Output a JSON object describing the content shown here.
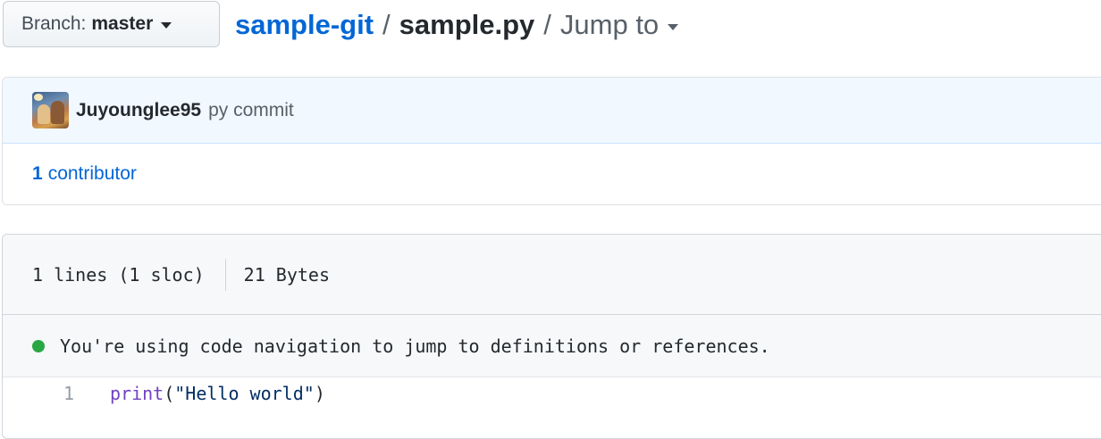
{
  "branch": {
    "prefix": "Branch:",
    "name": "master"
  },
  "breadcrumb": {
    "repo": "sample-git",
    "separator": "/",
    "file": "sample.py",
    "jump_to": "Jump to"
  },
  "commit": {
    "author": "Juyounglee95",
    "message": "py commit",
    "contributors_count": "1",
    "contributors_label": "contributor"
  },
  "file": {
    "lines_info": "1 lines (1 sloc)",
    "size": "21 Bytes",
    "code_nav_notice": "You're using code navigation to jump to definitions or references.",
    "code_lines": [
      {
        "number": "1",
        "builtin": "print",
        "open": "(",
        "string": "\"Hello world\"",
        "close": ")"
      }
    ]
  },
  "colors": {
    "link": "#0366d6",
    "nav_dot": "#28a745",
    "builtin": "#6f42c1",
    "string": "#032f62",
    "commit_bg": "#f1f8ff"
  },
  "icons": {
    "branch_caret": "chevron-down-icon",
    "jump_caret": "chevron-down-icon",
    "nav_status": "green-dot-icon",
    "author_avatar": "avatar-image"
  }
}
